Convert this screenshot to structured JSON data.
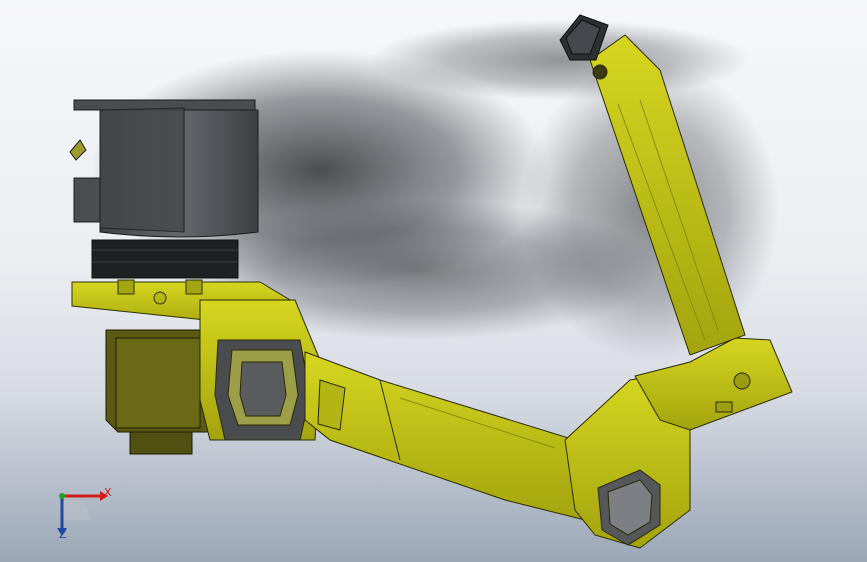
{
  "viewport": {
    "triad": {
      "x_label": "X",
      "z_label": "Z"
    }
  },
  "colors": {
    "robot_yellow": "#c8c80f",
    "robot_yellow_dark": "#8f8f10",
    "motor_gray": "#55575b",
    "axis_x": "#d21b1b",
    "axis_y": "#1aa81a",
    "axis_z": "#1e4aa8"
  },
  "icons": {
    "triad": "xyz-triad-icon"
  }
}
